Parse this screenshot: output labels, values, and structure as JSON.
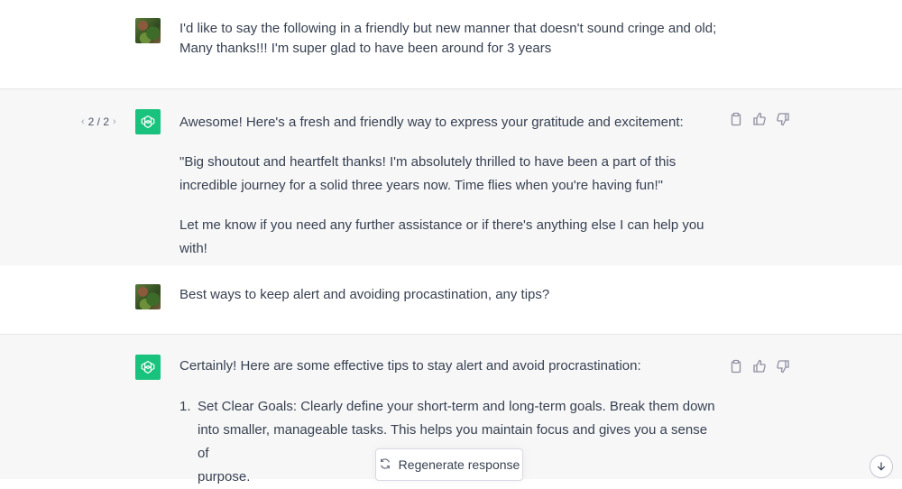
{
  "messages": [
    {
      "role": "user",
      "lines": [
        "I'd like to say the following in a friendly but new manner that doesn't sound cringe and old;",
        "Many thanks!!! I'm super glad to have been around for 3 years"
      ]
    },
    {
      "role": "assistant",
      "pager": "2 / 2",
      "intro": "Awesome! Here's a fresh and friendly way to express your gratitude and excitement:",
      "quote_lines": [
        "\"Big shoutout and heartfelt thanks! I'm absolutely thrilled to have been a part of this",
        "incredible journey for a solid three years now. Time flies when you're having fun!\""
      ],
      "closing": "Let me know if you need any further assistance or if there's anything else I can help you with!"
    },
    {
      "role": "user",
      "lines": [
        "Best ways to keep alert and avoiding procastination, any tips?"
      ]
    },
    {
      "role": "assistant",
      "intro": "Certainly! Here are some effective tips to stay alert and avoid procrastination:",
      "list": [
        {
          "number": "1.",
          "lines": [
            "Set Clear Goals: Clearly define your short-term and long-term goals. Break them down",
            "into smaller, manageable tasks. This helps you maintain focus and gives you a sense of",
            "purpose."
          ]
        }
      ]
    }
  ],
  "regenerate_label": "Regenerate response",
  "icons": {
    "copy": "clipboard-icon",
    "thumbs_up": "thumbs-up-icon",
    "thumbs_down": "thumbs-down-icon",
    "regenerate": "refresh-icon",
    "scroll": "arrow-down-icon",
    "gpt_logo": "openai-logo-icon"
  },
  "colors": {
    "gpt_green": "#19c37d",
    "assistant_bg": "#f7f7f8",
    "text": "#374151"
  }
}
